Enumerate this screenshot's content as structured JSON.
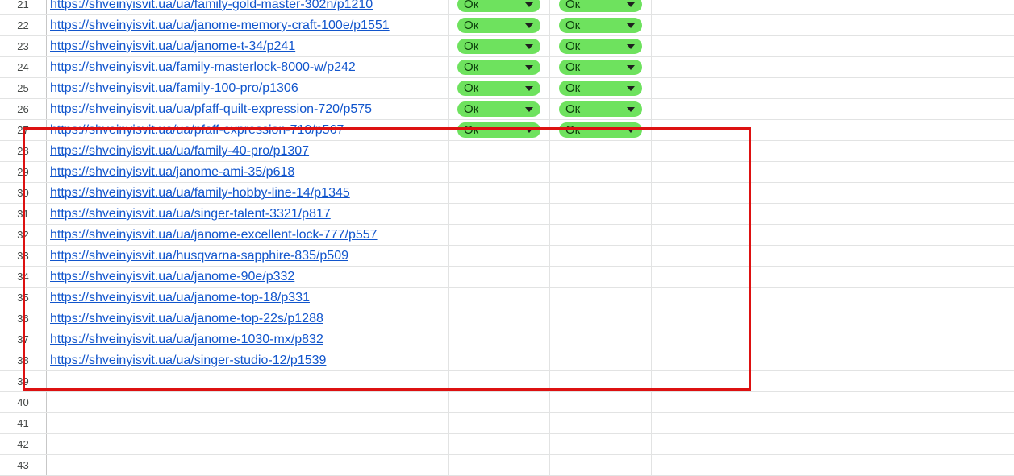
{
  "colors": {
    "status_ok": "#6ee25e",
    "link": "#1155cc",
    "highlight": "#dd1111"
  },
  "status_dropdown": {
    "icon": "triangle-down-icon"
  },
  "rows": [
    {
      "num": "21",
      "url": "https://shveinyisvit.ua/ua/family-gold-master-302n/p1210",
      "status1": "Ок",
      "status2": "Ок"
    },
    {
      "num": "22",
      "url": "https://shveinyisvit.ua/ua/janome-memory-craft-100e/p1551",
      "status1": "Ок",
      "status2": "Ок"
    },
    {
      "num": "23",
      "url": "https://shveinyisvit.ua/ua/janome-t-34/p241",
      "status1": "Ок",
      "status2": "Ок"
    },
    {
      "num": "24",
      "url": "https://shveinyisvit.ua/family-masterlock-8000-w/p242",
      "status1": "Ок",
      "status2": "Ок"
    },
    {
      "num": "25",
      "url": "https://shveinyisvit.ua/family-100-pro/p1306",
      "status1": "Ок",
      "status2": "Ок"
    },
    {
      "num": "26",
      "url": "https://shveinyisvit.ua/ua/pfaff-quilt-expression-720/p575",
      "status1": "Ок",
      "status2": "Ок"
    },
    {
      "num": "27",
      "url": "https://shveinyisvit.ua/ua/pfaff-expression-710/p567",
      "status1": "Ок",
      "status2": "Ок"
    },
    {
      "num": "28",
      "url": "https://shveinyisvit.ua/ua/family-40-pro/p1307",
      "status1": "",
      "status2": ""
    },
    {
      "num": "29",
      "url": "https://shveinyisvit.ua/janome-ami-35/p618",
      "status1": "",
      "status2": ""
    },
    {
      "num": "30",
      "url": "https://shveinyisvit.ua/ua/family-hobby-line-14/p1345",
      "status1": "",
      "status2": ""
    },
    {
      "num": "31",
      "url": "https://shveinyisvit.ua/ua/singer-talent-3321/p817",
      "status1": "",
      "status2": ""
    },
    {
      "num": "32",
      "url": "https://shveinyisvit.ua/ua/janome-excellent-lock-777/p557",
      "status1": "",
      "status2": ""
    },
    {
      "num": "33",
      "url": "https://shveinyisvit.ua/husqvarna-sapphire-835/p509",
      "status1": "",
      "status2": ""
    },
    {
      "num": "34",
      "url": "https://shveinyisvit.ua/ua/janome-90e/p332",
      "status1": "",
      "status2": ""
    },
    {
      "num": "35",
      "url": "https://shveinyisvit.ua/ua/janome-top-18/p331",
      "status1": "",
      "status2": ""
    },
    {
      "num": "36",
      "url": "https://shveinyisvit.ua/ua/janome-top-22s/p1288",
      "status1": "",
      "status2": ""
    },
    {
      "num": "37",
      "url": "https://shveinyisvit.ua/ua/janome-1030-mx/p832",
      "status1": "",
      "status2": ""
    },
    {
      "num": "38",
      "url": "https://shveinyisvit.ua/ua/singer-studio-12/p1539",
      "status1": "",
      "status2": ""
    },
    {
      "num": "39",
      "url": "",
      "status1": "",
      "status2": ""
    },
    {
      "num": "40",
      "url": "",
      "status1": "",
      "status2": ""
    },
    {
      "num": "41",
      "url": "",
      "status1": "",
      "status2": ""
    },
    {
      "num": "42",
      "url": "",
      "status1": "",
      "status2": ""
    },
    {
      "num": "43",
      "url": "",
      "status1": "",
      "status2": ""
    }
  ]
}
